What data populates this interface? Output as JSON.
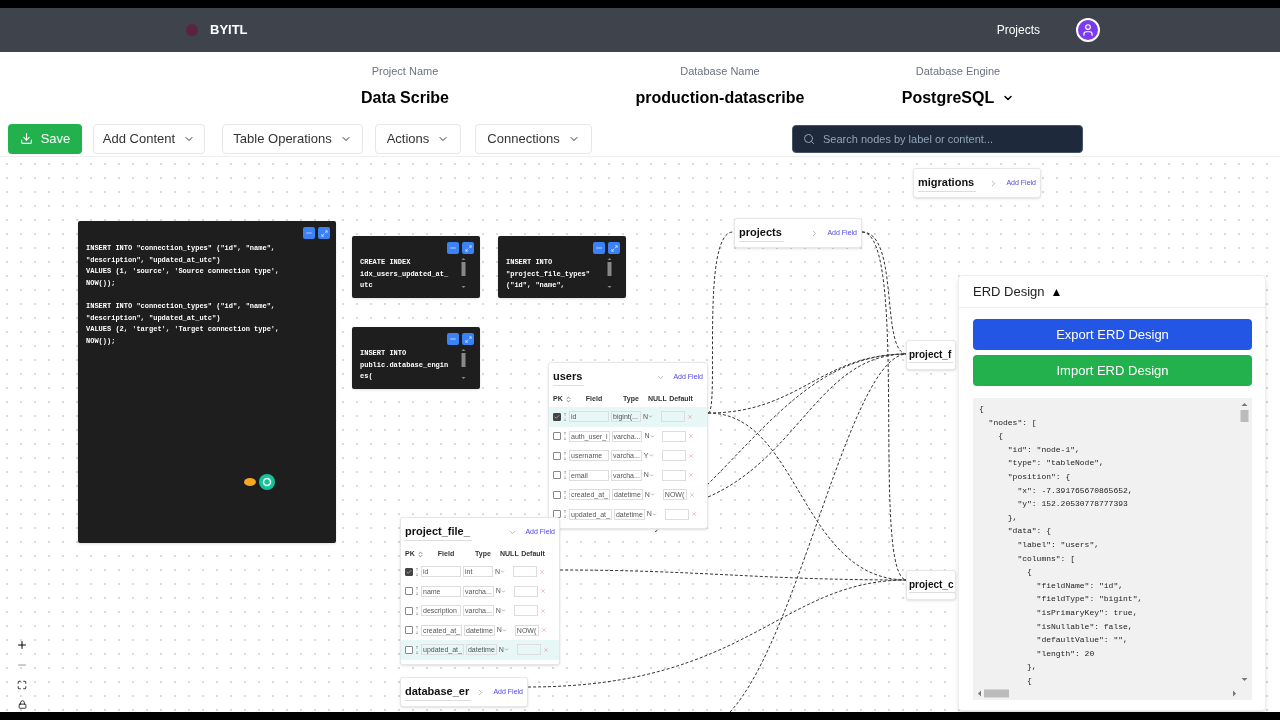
{
  "header": {
    "brand": "BYITL",
    "nav_link": "Projects"
  },
  "project": [
    {
      "label": "Project Name",
      "value": "Data Scribe",
      "kind": "text"
    },
    {
      "label": "Database Name",
      "value": "production-datascribe",
      "kind": "text"
    },
    {
      "label": "Database Engine",
      "value": "PostgreSQL",
      "kind": "select"
    }
  ],
  "toolbar": {
    "save": "Save",
    "menus": [
      "Add Content",
      "Table Operations",
      "Actions",
      "Connections"
    ],
    "search": {
      "placeholder": "Search nodes by label or content..."
    }
  },
  "sql_nodes": [
    {
      "blocks": [
        [
          "INSERT INTO \"connection_types\" (\"id\", \"name\",",
          "\"description\", \"updated_at_utc\")",
          "VALUES (1, 'source', 'Source connection type',",
          "NOW());"
        ],
        [
          "INSERT INTO \"connection_types\" (\"id\", \"name\",",
          "\"description\", \"updated_at_utc\")",
          "VALUES (2, 'target', 'Target connection type',",
          "NOW());"
        ]
      ]
    },
    {
      "blocks": [
        [
          "CREATE INDEX",
          "idx_users_updated_at_",
          "utc"
        ]
      ]
    },
    {
      "blocks": [
        [
          "INSERT INTO",
          "\"project_file_types\"",
          "(\"id\", \"name\","
        ]
      ]
    },
    {
      "blocks": [
        [
          "INSERT INTO",
          "public.database_engin",
          "es("
        ]
      ]
    }
  ],
  "tables": [
    {
      "label": "users",
      "expanded": true,
      "add_label": "Add Field",
      "columns": [
        "PK",
        "Field",
        "Type",
        "NULL",
        "Default"
      ],
      "rows": [
        {
          "pk": true,
          "highlighted": true,
          "field": "id",
          "type": "bigint(...",
          "null": "N",
          "default": ""
        },
        {
          "pk": false,
          "highlighted": false,
          "field": "auth_user_i",
          "type": "varcha...",
          "null": "N",
          "default": ""
        },
        {
          "pk": false,
          "highlighted": false,
          "field": "username",
          "type": "varcha...",
          "null": "Y",
          "default": ""
        },
        {
          "pk": false,
          "highlighted": false,
          "field": "email",
          "type": "varcha...",
          "null": "N",
          "default": ""
        },
        {
          "pk": false,
          "highlighted": false,
          "field": "created_at_",
          "type": "datetime",
          "null": "N",
          "default": "NOW("
        },
        {
          "pk": false,
          "highlighted": false,
          "field": "updated_at_",
          "type": "datetime",
          "null": "N",
          "default": ""
        }
      ]
    },
    {
      "label": "project_file_",
      "expanded": true,
      "add_label": "Add Field",
      "columns": [
        "PK",
        "Field",
        "Type",
        "NULL",
        "Default"
      ],
      "rows": [
        {
          "pk": true,
          "highlighted": false,
          "field": "id",
          "type": "int",
          "null": "N",
          "default": ""
        },
        {
          "pk": false,
          "highlighted": false,
          "field": "name",
          "type": "varcha...",
          "null": "N",
          "default": ""
        },
        {
          "pk": false,
          "highlighted": false,
          "field": "description",
          "type": "varcha...",
          "null": "N",
          "default": ""
        },
        {
          "pk": false,
          "highlighted": false,
          "field": "created_at_",
          "type": "datetime",
          "null": "N",
          "default": "NOW("
        },
        {
          "pk": false,
          "highlighted": true,
          "field": "updated_at_",
          "type": "datetime",
          "null": "N",
          "default": ""
        }
      ]
    },
    {
      "label": "database_er",
      "expanded": false,
      "add_label": "Add Field"
    },
    {
      "label": "projects",
      "expanded": false,
      "add_label": "Add Field"
    },
    {
      "label": "migrations",
      "expanded": false,
      "add_label": "Add Field"
    },
    {
      "label": "project_f"
    },
    {
      "label": "project_c"
    }
  ],
  "erd_panel": {
    "title": "ERD Design",
    "toggle": "▲",
    "export": "Export ERD Design",
    "import": "Import ERD Design",
    "code": [
      "{",
      "  \"nodes\": [",
      "    {",
      "      \"id\": \"node-1\",",
      "      \"type\": \"tableNode\",",
      "      \"position\": {",
      "        \"x\": -7.391765670865652,",
      "        \"y\": 152.20530778777393",
      "      },",
      "      \"data\": {",
      "        \"label\": \"users\",",
      "        \"columns\": [",
      "          {",
      "            \"fieldName\": \"id\",",
      "            \"fieldType\": \"bigint\",",
      "            \"isPrimaryKey\": true,",
      "            \"isNullable\": false,",
      "            \"defaultValue\": \"\",",
      "            \"length\": 20",
      "          },",
      "          {"
    ]
  }
}
